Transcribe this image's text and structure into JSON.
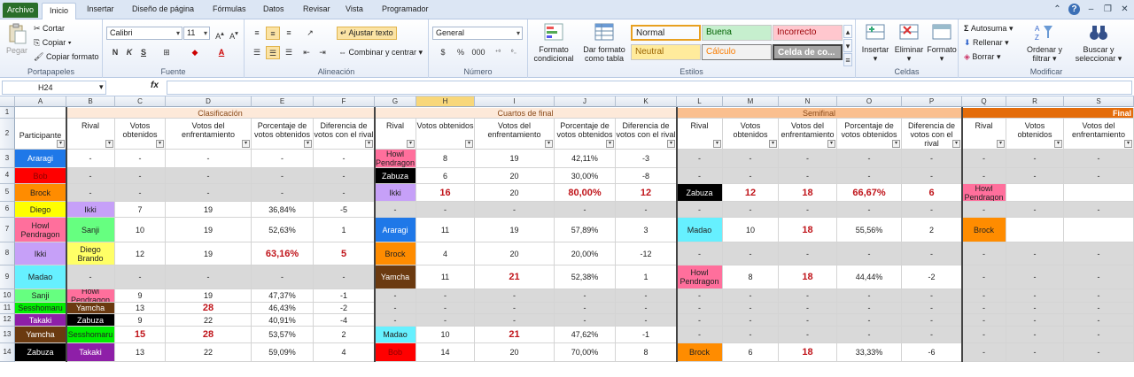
{
  "tabs": {
    "file": "Archivo",
    "items": [
      "Inicio",
      "Insertar",
      "Diseño de página",
      "Fórmulas",
      "Datos",
      "Revisar",
      "Vista",
      "Programador"
    ]
  },
  "ribbon": {
    "clipboard": {
      "paste": "Pegar",
      "cut": "Cortar",
      "copy": "Copiar",
      "format_painter": "Copiar formato",
      "label": "Portapapeles"
    },
    "font": {
      "name": "Calibri",
      "size": "11",
      "bold": "N",
      "italic": "K",
      "underline": "S",
      "label": "Fuente"
    },
    "alignment": {
      "wrap": "Ajustar texto",
      "merge": "Combinar y centrar",
      "label": "Alineación"
    },
    "number": {
      "format": "General",
      "currency": "$",
      "percent": "%",
      "thousands": "000",
      "label": "Número"
    },
    "styles": {
      "cond_format": "Formato condicional",
      "table_format": "Dar formato como tabla",
      "label": "Estilos",
      "cells": [
        {
          "name": "Normal",
          "bg": "#ffffff",
          "fg": "#000000"
        },
        {
          "name": "Buena",
          "bg": "#c6efce",
          "fg": "#006100"
        },
        {
          "name": "Incorrecto",
          "bg": "#ffc7ce",
          "fg": "#9c0006"
        },
        {
          "name": "Neutral",
          "bg": "#ffeb9c",
          "fg": "#9c6500"
        },
        {
          "name": "Cálculo",
          "bg": "#f2f2f2",
          "fg": "#fa7d00"
        },
        {
          "name": "Celda de co...",
          "bg": "#a5a5a5",
          "fg": "#ffffff"
        }
      ]
    },
    "cells": {
      "insert": "Insertar",
      "delete": "Eliminar",
      "format": "Formato",
      "label": "Celdas"
    },
    "edit": {
      "autosum": "Autosuma",
      "fill": "Rellenar",
      "clear": "Borrar",
      "sort": "Ordenar y filtrar",
      "find": "Buscar y seleccionar",
      "label": "Modificar"
    }
  },
  "formula_bar": {
    "name_box": "H24",
    "fx": "fx",
    "value": ""
  },
  "columns": [
    "A",
    "B",
    "C",
    "D",
    "E",
    "F",
    "G",
    "H",
    "I",
    "J",
    "K",
    "L",
    "M",
    "N",
    "O",
    "P",
    "Q",
    "R",
    "S"
  ],
  "selected_column": "H",
  "rows": [
    "1",
    "2",
    "3",
    "4",
    "5",
    "6",
    "7",
    "8",
    "9",
    "10",
    "11",
    "12",
    "13",
    "14"
  ],
  "groups": [
    {
      "label": "Clasificación",
      "bg": "#fde9d9"
    },
    {
      "label": "Cuartos de final",
      "bg": "#fde9d9"
    },
    {
      "label": "Semifinal",
      "bg": "#fabf8f"
    },
    {
      "label": "Final",
      "bg": "#e46c0a"
    }
  ],
  "headers": [
    "Participante",
    "Rival",
    "Votos obtenidos",
    "Votos del enfrentamiento",
    "Porcentaje de votos obtenidos",
    "Diferencia de votos con el rival",
    "Rival",
    "Votos obtenidos",
    "Votos del enfrentamiento",
    "Porcentaje de votos obtenidos",
    "Diferencia de votos con el rival",
    "Rival",
    "Votos obtenidos",
    "Votos del enfrentamiento",
    "Porcentaje de votos obtenidos",
    "Diferencia de votos con el rival",
    "Rival",
    "Votos obtenidos",
    "Votos del enfrentamiento"
  ],
  "colors": {
    "Araragi": "#1f78e8",
    "Bob": "#ff0000",
    "Brock": "#ff8c00",
    "Diego": "#ffff00",
    "Diego Brando": "#ffff66",
    "Howl Pendragon": "#ff6f9c",
    "Ikki": "#c6a0f8",
    "Madao": "#66f0ff",
    "Sanji": "#66ff80",
    "Sesshomaru": "#00ee00",
    "Takaki": "#8e1fa8",
    "Yamcha": "#6b3a10",
    "Zabuza": "#000000",
    "gray": "#d9d9d9"
  },
  "table": [
    [
      "Araragi",
      "-",
      "-",
      "-",
      "-",
      "-",
      "Howl Pendragon",
      "8",
      "19",
      "42,11%",
      "-3",
      "-",
      "-",
      "-",
      "-",
      "-",
      "-",
      "-",
      "-"
    ],
    [
      "Bob",
      "-",
      "-",
      "-",
      "-",
      "-",
      "Zabuza",
      "6",
      "20",
      "30,00%",
      "-8",
      "-",
      "-",
      "-",
      "-",
      "-",
      "-",
      "-",
      "-"
    ],
    [
      "Brock",
      "-",
      "-",
      "-",
      "-",
      "-",
      "Ikki",
      "16",
      "20",
      "80,00%",
      "12",
      "Zabuza",
      "12",
      "18",
      "66,67%",
      "6",
      "Howl Pendragon",
      "",
      ""
    ],
    [
      "Diego",
      "Ikki",
      "7",
      "19",
      "36,84%",
      "-5",
      "-",
      "-",
      "-",
      "-",
      "-",
      "-",
      "-",
      "-",
      "-",
      "-",
      "-",
      "-",
      "-"
    ],
    [
      "Howl Pendragon",
      "Sanji",
      "10",
      "19",
      "52,63%",
      "1",
      "Araragi",
      "11",
      "19",
      "57,89%",
      "3",
      "Madao",
      "10",
      "18",
      "55,56%",
      "2",
      "Brock",
      "",
      ""
    ],
    [
      "Ikki",
      "Diego Brando",
      "12",
      "19",
      "63,16%",
      "5",
      "Brock",
      "4",
      "20",
      "20,00%",
      "-12",
      "-",
      "-",
      "-",
      "-",
      "-",
      "-",
      "-",
      "-"
    ],
    [
      "Madao",
      "-",
      "-",
      "-",
      "-",
      "-",
      "Yamcha",
      "11",
      "21",
      "52,38%",
      "1",
      "Howl Pendragon",
      "8",
      "18",
      "44,44%",
      "-2",
      "-",
      "-",
      "-"
    ],
    [
      "Sanji",
      "Howl Pendragon",
      "9",
      "19",
      "47,37%",
      "-1",
      "-",
      "-",
      "-",
      "-",
      "-",
      "-",
      "-",
      "-",
      "-",
      "-",
      "-",
      "-",
      "-"
    ],
    [
      "Sesshomaru",
      "Yamcha",
      "13",
      "28",
      "46,43%",
      "-2",
      "-",
      "-",
      "-",
      "-",
      "-",
      "-",
      "-",
      "-",
      "-",
      "-",
      "-",
      "-",
      "-"
    ],
    [
      "Takaki",
      "Zabuza",
      "9",
      "22",
      "40,91%",
      "-4",
      "-",
      "-",
      "-",
      "-",
      "-",
      "-",
      "-",
      "-",
      "-",
      "-",
      "-",
      "-",
      "-"
    ],
    [
      "Yamcha",
      "Sesshomaru",
      "15",
      "28",
      "53,57%",
      "2",
      "Madao",
      "10",
      "21",
      "47,62%",
      "-1",
      "-",
      "-",
      "-",
      "-",
      "-",
      "-",
      "-",
      "-"
    ],
    [
      "Zabuza",
      "Takaki",
      "13",
      "22",
      "59,09%",
      "4",
      "Bob",
      "14",
      "20",
      "70,00%",
      "8",
      "Brock",
      "6",
      "18",
      "33,33%",
      "-6",
      "-",
      "-",
      "-"
    ]
  ]
}
